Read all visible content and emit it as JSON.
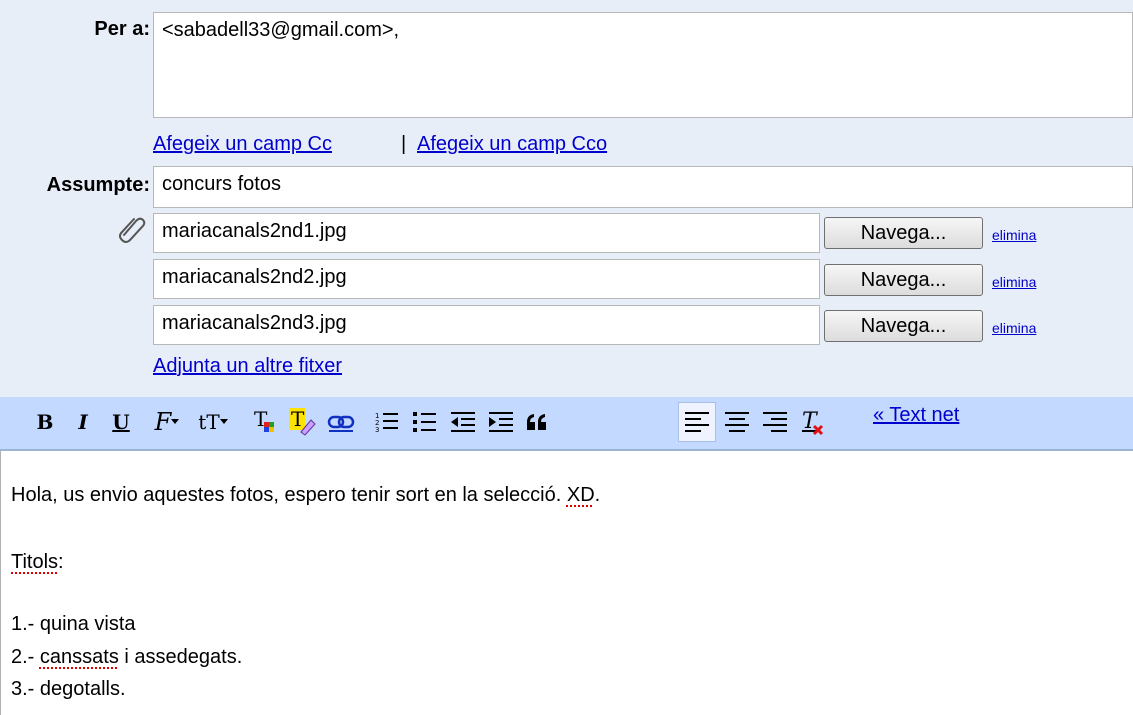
{
  "to": {
    "label": "Per a:",
    "value": "<sabadell33@gmail.com>,"
  },
  "cc_links": {
    "add_cc": "Afegeix un camp Cc",
    "separator": "|",
    "add_bcc": "Afegeix un camp Cco"
  },
  "subject": {
    "label": "Assumpte:",
    "value": "concurs fotos"
  },
  "attachments": {
    "items": [
      {
        "filename": "mariacanals2nd1.jpg",
        "browse": "Navega...",
        "remove": "elimina"
      },
      {
        "filename": "mariacanals2nd2.jpg",
        "browse": "Navega...",
        "remove": "elimina"
      },
      {
        "filename": "mariacanals2nd3.jpg",
        "browse": "Navega...",
        "remove": "elimina"
      }
    ],
    "add_another": "Adjunta un altre fitxer"
  },
  "toolbar": {
    "bold": "B",
    "italic": "I",
    "underline": "U",
    "font": "F",
    "size": "tT",
    "plain_text_link": "« Text net"
  },
  "body": {
    "line1_prefix": "Hola, us envio aquestes fotos, espero tenir sort en la selecció. ",
    "line1_misspelled": "XD",
    "line1_suffix": ".",
    "line2_misspelled": "Titols",
    "line2_suffix": ":",
    "item1": "1.- quina vista",
    "item2_prefix": "2.- ",
    "item2_misspelled": "canssats",
    "item2_suffix": " i assedegats.",
    "item3": "3.- degotalls."
  },
  "colors": {
    "compose_bg": "#e8eef7",
    "toolbar_bg": "#c3d9ff",
    "link": "#0000cc",
    "spell_underline": "#e00000"
  }
}
